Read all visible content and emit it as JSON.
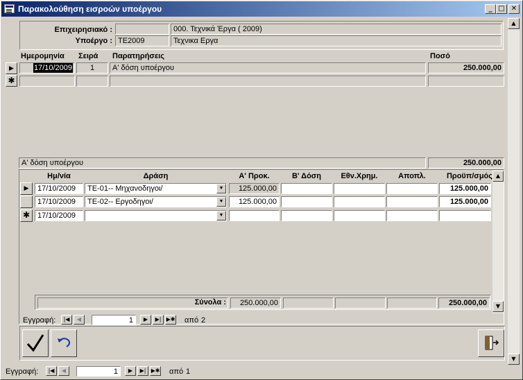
{
  "window": {
    "title": "Παρακολούθηση εισροών υποέργου"
  },
  "header": {
    "company_label": "Επιχειρησιακό :",
    "company_code": "",
    "company_name": "000. Τεχνικά Έργα ( 2009)",
    "subproject_label": "Υποέργο :",
    "subproject_code": "ΤΕ2009",
    "subproject_name": "Τεχνικα Εργα"
  },
  "main_table": {
    "columns": [
      "Ημερομηνία",
      "Σειρά",
      "Παρατηρήσεις",
      "Ποσό"
    ],
    "rows": [
      {
        "date": "17/10/2009",
        "order": "1",
        "notes": "Α' δόση υποέργου",
        "amount": "250.000,00"
      }
    ]
  },
  "summary": {
    "text": "Α' δόση υποέργου",
    "amount": "250.000,00"
  },
  "sub_table": {
    "columns": [
      "Ημ/νία",
      "Δράση",
      "Α' Προκ.",
      "Β' Δόση",
      "Εθν.Χρημ.",
      "Αποπλ.",
      "Προϋπ/σμός"
    ],
    "rows": [
      {
        "date": "17/10/2009",
        "action": "ΤΕ-01-- Μηχανοδηγοι/",
        "a": "125.000,00",
        "budget": "125.000,00"
      },
      {
        "date": "17/10/2009",
        "action": "ΤΕ-02-- Εργοδηγοι/",
        "a": "125.000,00",
        "budget": "125.000,00"
      }
    ],
    "new_row_date": "17/10/2009",
    "totals_label": "Σύνολα :",
    "totals_a": "250.000,00",
    "totals_budget": "250.000,00"
  },
  "sub_nav": {
    "label": "Εγγραφή:",
    "current": "1",
    "of_label": "από",
    "total": "2"
  },
  "main_nav": {
    "label": "Εγγραφή:",
    "current": "1",
    "of_label": "από",
    "total": "1"
  },
  "icons": {
    "save": "checkmark-icon",
    "undo": "undo-icon",
    "exit": "exit-door-icon"
  }
}
